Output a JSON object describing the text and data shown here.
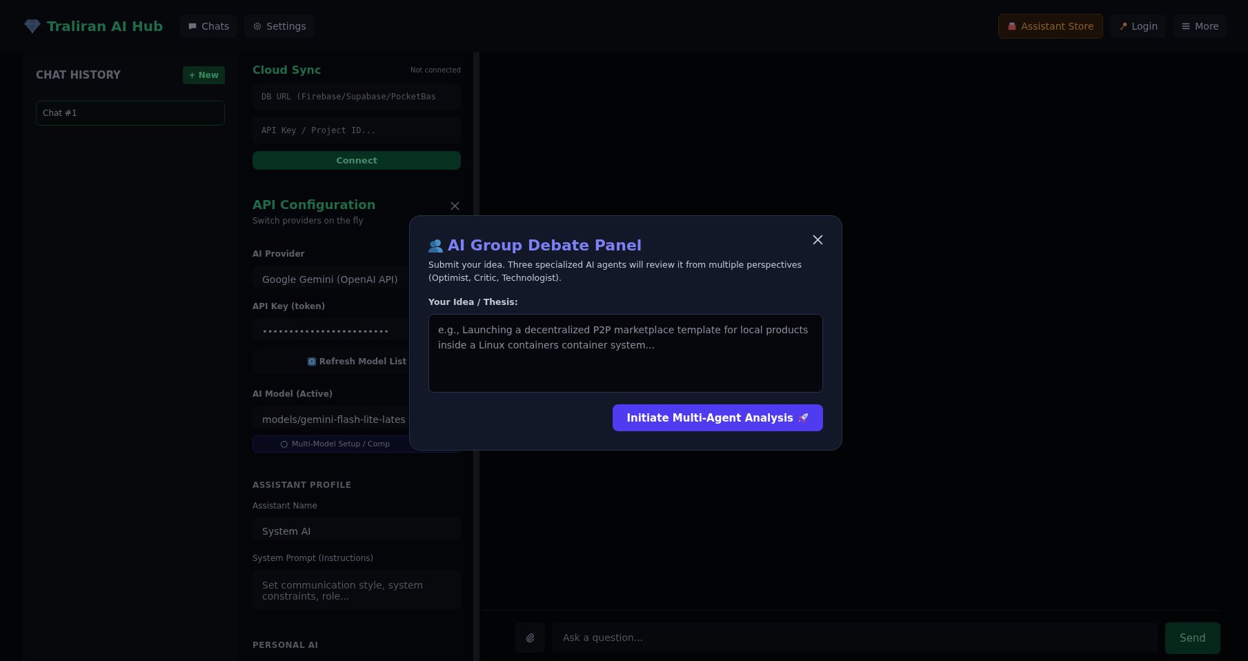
{
  "header": {
    "brand": "Traliran AI Hub",
    "nav": [
      {
        "label": "Chats",
        "kind": "chat",
        "selected": false
      },
      {
        "label": "Settings",
        "kind": "gear",
        "selected": false
      }
    ],
    "actions": [
      {
        "label": "Assistant Store",
        "kind": "store"
      },
      {
        "label": "Login",
        "kind": "key"
      },
      {
        "label": "More",
        "kind": "menu"
      }
    ]
  },
  "sidebar": {
    "title": "CHAT HISTORY",
    "new_button": "+ New",
    "chats": [
      {
        "label": "Chat #1",
        "selected": true
      }
    ]
  },
  "cloud_sync": {
    "title": "Cloud Sync",
    "status": "Not connected",
    "fields": [
      {
        "placeholder": "DB URL (Firebase/Supabase/PocketBas"
      },
      {
        "placeholder": "API Key / Project ID..."
      }
    ],
    "button": "Connect"
  },
  "api_config": {
    "title": "API Configuration",
    "subtitle": "Switch providers on the fly",
    "provider_label": "AI Provider",
    "provider_value": "Google Gemini (OpenAI API)",
    "key_label": "API Key (token)",
    "key_value": "••••••••••••••••••••••••",
    "refresh_button": "Refresh Model List",
    "model_label": "AI Model (Active)",
    "model_value": "models/gemini-flash-lite-lates",
    "multi_button": "Multi-Model Setup / Comp"
  },
  "profile": {
    "heading": "ASSISTANT PROFILE",
    "name_label": "Assistant Name",
    "name_value": "System AI",
    "prompt_label": "System Prompt (Instructions)",
    "prompt_placeholder": "Set communication style, system constraints, role..."
  },
  "personal": {
    "heading": "PERSONAL AI"
  },
  "composer": {
    "placeholder": "Ask a question...",
    "send": "Send"
  },
  "modal": {
    "title": "AI Group Debate Panel",
    "description": "Submit your idea. Three specialized AI agents will review it from multiple perspectives (Optimist, Critic, Technologist).",
    "label": "Your Idea / Thesis:",
    "placeholder": "e.g., Launching a decentralized P2P marketplace template for local products inside a Linux containers container system...",
    "button": "Initiate Multi-Agent Analysis"
  }
}
